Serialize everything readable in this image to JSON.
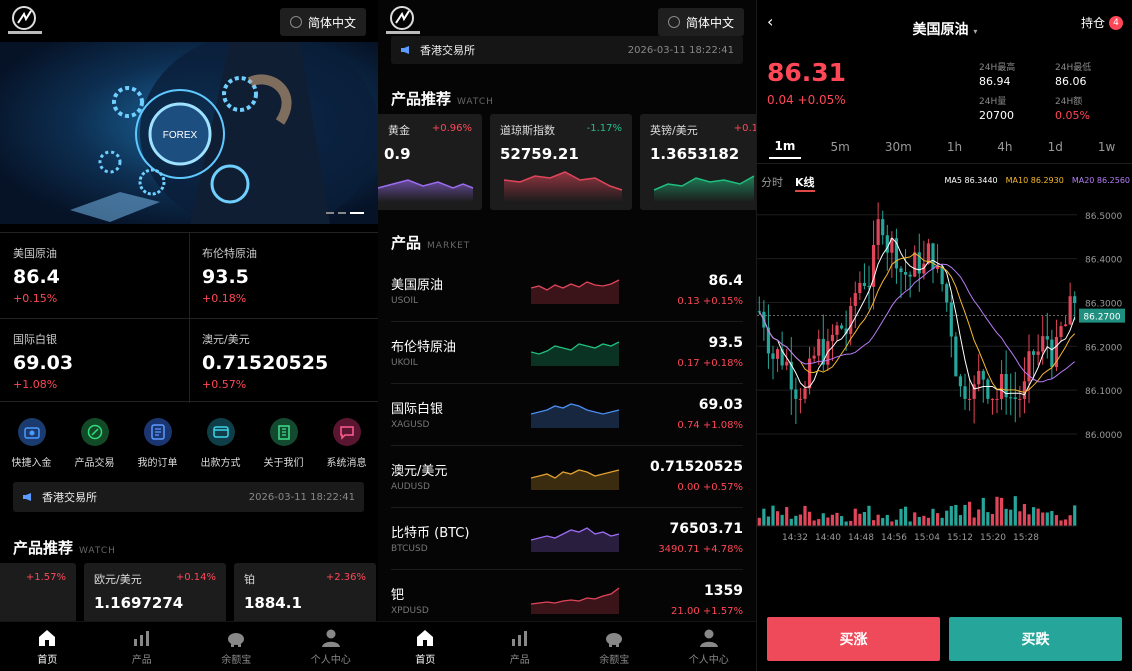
{
  "colors": {
    "up": "#ff4757",
    "down": "#1fbf8f",
    "accent": "#ff4757",
    "bg": "#000000"
  },
  "lang": "简体中文",
  "home": {
    "quotes": [
      {
        "name": "美国原油",
        "price": "86.4",
        "change": "+0.15%"
      },
      {
        "name": "布伦特原油",
        "price": "93.5",
        "change": "+0.18%"
      },
      {
        "name": "国际白银",
        "price": "69.03",
        "change": "+1.08%"
      },
      {
        "name": "澳元/美元",
        "price": "0.71520525",
        "change": "+0.57%"
      }
    ],
    "actions": [
      {
        "label": "快捷入金",
        "icon": "camera-icon",
        "color": "#2f7de1"
      },
      {
        "label": "产品交易",
        "icon": "percent-icon",
        "color": "#1fbf5f"
      },
      {
        "label": "我的订单",
        "icon": "document-icon",
        "color": "#3b7ff0"
      },
      {
        "label": "出款方式",
        "icon": "card-icon",
        "color": "#29b3c9"
      },
      {
        "label": "关于我们",
        "icon": "building-icon",
        "color": "#2ec27e"
      },
      {
        "label": "系统消息",
        "icon": "message-icon",
        "color": "#e8457a"
      }
    ],
    "notice": {
      "text": "香港交易所",
      "date": "2026-03-11 18:22:41"
    },
    "watch_title": "产品推荐",
    "watch_sub": "WATCH",
    "watch_cards": [
      {
        "name": "",
        "change": "+1.57%",
        "price": ""
      },
      {
        "name": "欧元/美元",
        "change": "+0.14%",
        "price": "1.1697274"
      },
      {
        "name": "铂",
        "change": "+2.36%",
        "price": "1884.1"
      }
    ]
  },
  "tabs": [
    "首页",
    "产品",
    "余额宝",
    "个人中心"
  ],
  "market": {
    "notice": {
      "text": "香港交易所",
      "date": "2026-03-11 18:22:41"
    },
    "watch_title": "产品推荐",
    "watch_sub": "WATCH",
    "watch_cards": [
      {
        "name": "黄金",
        "change": "+0.96%",
        "price": "0.9",
        "trend": "up"
      },
      {
        "name": "道琼斯指数",
        "change": "-1.17%",
        "price": "52759.21",
        "trend": "down"
      },
      {
        "name": "英镑/美元",
        "change": "+0.1",
        "price": "1.3653182",
        "trend": "up2"
      }
    ],
    "list_title": "产品",
    "list_sub": "MARKET",
    "items": [
      {
        "name": "美国原油",
        "code": "USOIL",
        "price": "86.4",
        "change": "0.13 +0.15%",
        "color": "#e0455a"
      },
      {
        "name": "布伦特原油",
        "code": "UKOIL",
        "price": "93.5",
        "change": "0.17 +0.18%",
        "color": "#1fbf7f"
      },
      {
        "name": "国际白银",
        "code": "XAGUSD",
        "price": "69.03",
        "change": "0.74 +1.08%",
        "color": "#4a8ef0"
      },
      {
        "name": "澳元/美元",
        "code": "AUDUSD",
        "price": "0.71520525",
        "change": "0.00 +0.57%",
        "color": "#e0a030"
      },
      {
        "name": "比特币 (BTC)",
        "code": "BTCUSD",
        "price": "76503.71",
        "change": "3490.71 +4.78%",
        "color": "#9b6cf0"
      },
      {
        "name": "钯",
        "code": "XPDUSD",
        "price": "1359",
        "change": "21.00 +1.57%",
        "color": "#e0455a"
      }
    ]
  },
  "detail": {
    "title": "美国原油",
    "hold": "持仓",
    "hold_count": "4",
    "price": "86.31",
    "change": "0.04 +0.05%",
    "stats": [
      {
        "label": "24H最高",
        "value": "86.94"
      },
      {
        "label": "24H最低",
        "value": "86.06"
      },
      {
        "label": "24H量",
        "value": "20700"
      },
      {
        "label": "24H额",
        "value": "0.05%"
      }
    ],
    "periods": [
      "1m",
      "5m",
      "30m",
      "1h",
      "4h",
      "1d",
      "1w"
    ],
    "modes": [
      "分时",
      "K线"
    ],
    "ma": [
      {
        "text": "MA5 86.3440",
        "color": "#ffffff"
      },
      {
        "text": "MA10 86.2930",
        "color": "#f5b830"
      },
      {
        "text": "MA20 86.2560",
        "color": "#b57cf5"
      }
    ],
    "current_price_label": "86.2700",
    "buy": "买涨",
    "sell": "买跌"
  },
  "chart_data": {
    "type": "candlestick",
    "y_ticks": [
      "86.5000",
      "86.4000",
      "86.3000",
      "86.2000",
      "86.1000",
      "86.0000"
    ],
    "x_ticks": [
      "14:32",
      "14:40",
      "14:48",
      "14:56",
      "15:04",
      "15:12",
      "15:20",
      "15:28"
    ],
    "ylim": [
      86.0,
      86.52
    ],
    "current": 86.27
  }
}
